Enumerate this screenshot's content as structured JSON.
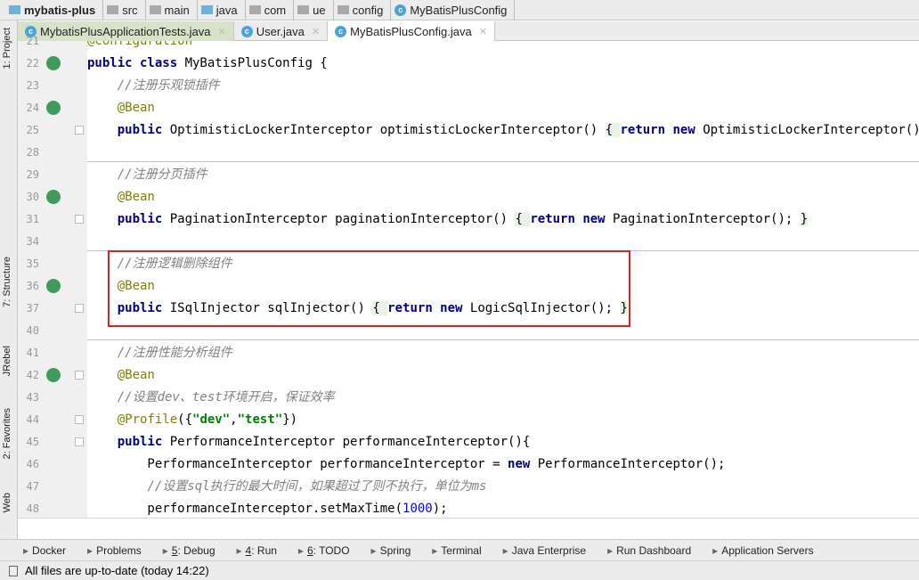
{
  "breadcrumb": [
    "mybatis-plus",
    "src",
    "main",
    "java",
    "com",
    "ue",
    "config",
    "MyBatisPlusConfig"
  ],
  "tabs": [
    {
      "label": "MybatisPlusApplicationTests.java",
      "state": "green"
    },
    {
      "label": "User.java",
      "state": ""
    },
    {
      "label": "MyBatisPlusConfig.java",
      "state": "active"
    }
  ],
  "left_tools": [
    "1: Project",
    "7: Structure",
    "JRebel",
    "2: Favorites",
    "Web"
  ],
  "code": [
    {
      "n": "21",
      "t": [
        [
          "an",
          "@Configuration"
        ]
      ]
    },
    {
      "n": "22",
      "t": [
        [
          "kw",
          "public class "
        ],
        [
          "",
          "MyBatisPlusConfig {"
        ]
      ]
    },
    {
      "n": "23",
      "t": [
        [
          "",
          "    "
        ],
        [
          "cm",
          "//注册乐观锁插件"
        ]
      ]
    },
    {
      "n": "24",
      "t": [
        [
          "",
          "    "
        ],
        [
          "an",
          "@Bean"
        ]
      ]
    },
    {
      "n": "25",
      "t": [
        [
          "",
          "    "
        ],
        [
          "kw",
          "public "
        ],
        [
          "",
          "OptimisticLockerInterceptor optimisticLockerInterceptor() "
        ],
        [
          "br",
          "{ "
        ],
        [
          "kw",
          "return new "
        ],
        [
          "",
          "OptimisticLockerInterceptor(); "
        ],
        [
          "br",
          "}"
        ]
      ]
    },
    {
      "n": "28",
      "t": []
    },
    {
      "n": "29",
      "t": [
        [
          "",
          "    "
        ],
        [
          "cm",
          "//注册分页插件"
        ]
      ]
    },
    {
      "n": "30",
      "t": [
        [
          "",
          "    "
        ],
        [
          "an",
          "@Bean"
        ]
      ]
    },
    {
      "n": "31",
      "t": [
        [
          "",
          "    "
        ],
        [
          "kw",
          "public "
        ],
        [
          "",
          "PaginationInterceptor paginationInterceptor() "
        ],
        [
          "br",
          "{ "
        ],
        [
          "kw",
          "return new "
        ],
        [
          "",
          "PaginationInterceptor(); "
        ],
        [
          "br",
          "}"
        ]
      ]
    },
    {
      "n": "34",
      "t": []
    },
    {
      "n": "35",
      "t": [
        [
          "",
          "    "
        ],
        [
          "cm",
          "//注册逻辑删除组件"
        ]
      ]
    },
    {
      "n": "36",
      "t": [
        [
          "",
          "    "
        ],
        [
          "an",
          "@Bean"
        ]
      ]
    },
    {
      "n": "37",
      "t": [
        [
          "",
          "    "
        ],
        [
          "kw",
          "public "
        ],
        [
          "",
          "ISqlInjector sqlInjector() "
        ],
        [
          "br",
          "{ "
        ],
        [
          "kw",
          "return new "
        ],
        [
          "",
          "LogicSqlInjector(); "
        ],
        [
          "br",
          "}"
        ]
      ]
    },
    {
      "n": "40",
      "t": []
    },
    {
      "n": "41",
      "t": [
        [
          "",
          "    "
        ],
        [
          "cm",
          "//注册性能分析组件"
        ]
      ]
    },
    {
      "n": "42",
      "t": [
        [
          "",
          "    "
        ],
        [
          "an",
          "@Bean"
        ]
      ]
    },
    {
      "n": "43",
      "t": [
        [
          "",
          "    "
        ],
        [
          "cm",
          "//设置dev、test环境开启，保证效率"
        ]
      ]
    },
    {
      "n": "44",
      "t": [
        [
          "",
          "    "
        ],
        [
          "an",
          "@Profile"
        ],
        [
          "",
          "({"
        ],
        [
          "st",
          "\"dev\""
        ],
        [
          "",
          ","
        ],
        [
          "st",
          "\"test\""
        ],
        [
          "",
          "})"
        ]
      ]
    },
    {
      "n": "45",
      "t": [
        [
          "",
          "    "
        ],
        [
          "kw",
          "public "
        ],
        [
          "",
          "PerformanceInterceptor performanceInterceptor(){"
        ]
      ]
    },
    {
      "n": "46",
      "t": [
        [
          "",
          "        PerformanceInterceptor performanceInterceptor = "
        ],
        [
          "kw",
          "new "
        ],
        [
          "",
          "PerformanceInterceptor();"
        ]
      ]
    },
    {
      "n": "47",
      "t": [
        [
          "",
          "        "
        ],
        [
          "cm",
          "//设置sql执行的最大时间，如果超过了则不执行，单位为ms"
        ]
      ]
    },
    {
      "n": "48",
      "t": [
        [
          "",
          "        performanceInterceptor.setMaxTime("
        ],
        [
          "nm",
          "1000"
        ],
        [
          "",
          ");"
        ]
      ]
    }
  ],
  "tool_windows": [
    {
      "num": "",
      "label": "Docker"
    },
    {
      "num": "",
      "label": "Problems"
    },
    {
      "num": "5",
      "label": ": Debug"
    },
    {
      "num": "4",
      "label": ": Run"
    },
    {
      "num": "6",
      "label": ": TODO"
    },
    {
      "num": "",
      "label": "Spring"
    },
    {
      "num": "",
      "label": "Terminal"
    },
    {
      "num": "",
      "label": "Java Enterprise"
    },
    {
      "num": "",
      "label": "Run Dashboard"
    },
    {
      "num": "",
      "label": "Application Servers"
    }
  ],
  "status": "All files are up-to-date (today 14:22)"
}
